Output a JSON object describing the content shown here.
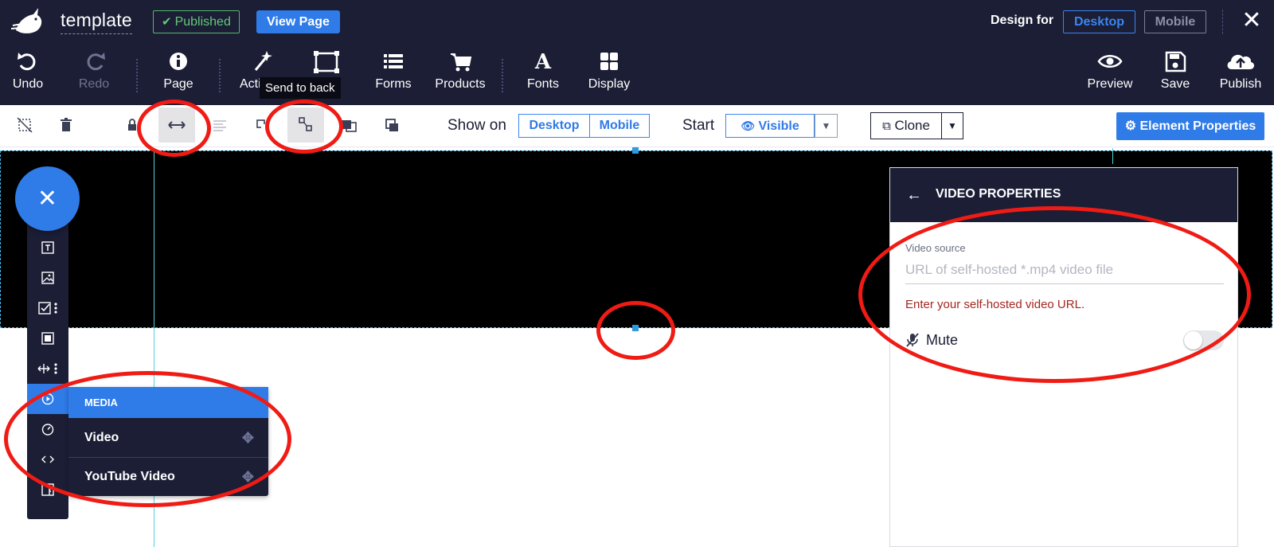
{
  "topbar": {
    "site_name": "template",
    "status_badge": "Published",
    "view_page": "View Page",
    "design_for_label": "Design for",
    "design_for_desktop": "Desktop",
    "design_for_mobile": "Mobile",
    "close_symbol": "✕"
  },
  "toolbar": {
    "undo": "Undo",
    "redo": "Redo",
    "page": "Page",
    "actions": "Acti",
    "tooltip": "Send to back",
    "forms": "Forms",
    "products": "Products",
    "fonts": "Fonts",
    "fonts_glyph": "A",
    "display": "Display",
    "preview": "Preview",
    "save": "Save",
    "publish": "Publish"
  },
  "element_toolbar": {
    "show_on_label": "Show on",
    "show_desktop": "Desktop",
    "show_mobile": "Mobile",
    "start_label": "Start",
    "visible": "Visible",
    "clone": "Clone",
    "element_properties": "Element Properties"
  },
  "media_menu": {
    "header": "MEDIA",
    "items": [
      "Video",
      "YouTube Video"
    ]
  },
  "video_properties": {
    "title": "VIDEO PROPERTIES",
    "source_label": "Video source",
    "source_placeholder": "URL of self-hosted *.mp4 video file",
    "error": "Enter your self-hosted video URL.",
    "mute_label": "Mute",
    "mute_on": false
  },
  "colors": {
    "dark_navy": "#1b1e35",
    "accent_blue": "#2f7be8",
    "published_green": "#63c97a",
    "annotation_red": "#ef1b14",
    "error_red": "#a3261f",
    "guide_cyan": "#4fd3df"
  },
  "icons": [
    "logo-icon",
    "check-icon",
    "undo-icon",
    "redo-icon",
    "info-icon",
    "magic-wand-icon",
    "send-to-back-icon",
    "list-icon",
    "cart-icon",
    "grid-icon",
    "eye-icon",
    "floppy-icon",
    "cloud-upload-icon",
    "close-icon",
    "deselect-icon",
    "trash-icon",
    "lock-icon",
    "stretch-icon",
    "align-icon",
    "bring-forward-icon",
    "send-backward-icon",
    "layers-icon",
    "copy-icon",
    "chevron-down-icon",
    "gear-icon",
    "text-icon",
    "image-icon",
    "checkbox-icon",
    "box-icon",
    "spacer-icon",
    "play-icon",
    "timer-icon",
    "code-icon",
    "facebook-icon",
    "move-icon",
    "arrow-left-icon",
    "mic-off-icon"
  ]
}
